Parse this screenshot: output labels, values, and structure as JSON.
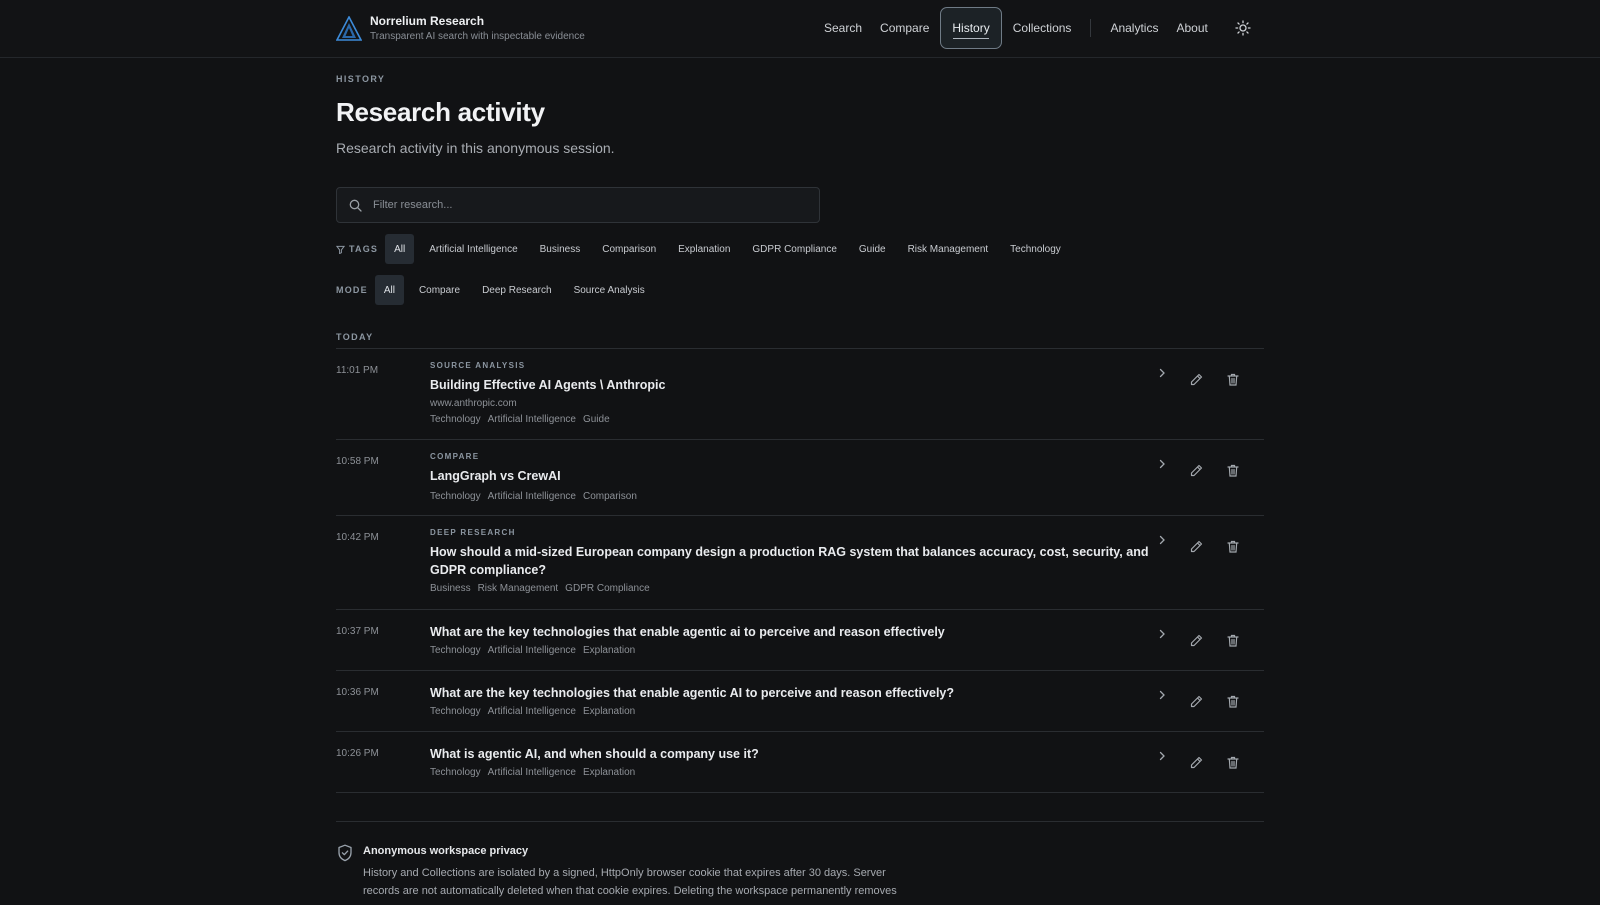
{
  "header": {
    "brand_name": "Norrelium Research",
    "brand_tagline": "Transparent AI search with inspectable evidence",
    "nav": {
      "search": "Search",
      "compare": "Compare",
      "history": "History",
      "collections": "Collections",
      "analytics": "Analytics",
      "about": "About"
    },
    "active_nav": "History"
  },
  "page": {
    "eyebrow": "HISTORY",
    "title": "Research activity",
    "subtitle": "Research activity in this anonymous session."
  },
  "search": {
    "placeholder": "Filter research...",
    "value": ""
  },
  "filters": {
    "tags_label": "TAGS",
    "tags": [
      "All",
      "Artificial Intelligence",
      "Business",
      "Comparison",
      "Explanation",
      "GDPR Compliance",
      "Guide",
      "Risk Management",
      "Technology"
    ],
    "mode_label": "MODE",
    "modes": [
      "All",
      "Compare",
      "Deep Research",
      "Source Analysis"
    ]
  },
  "history": {
    "group_label": "TODAY",
    "items": [
      {
        "time": "11:01 PM",
        "mode": "SOURCE ANALYSIS",
        "title": "Building Effective AI Agents \\ Anthropic",
        "url": "www.anthropic.com",
        "tags": [
          "Technology",
          "Artificial Intelligence",
          "Guide"
        ]
      },
      {
        "time": "10:58 PM",
        "mode": "COMPARE",
        "title": "LangGraph vs CrewAI",
        "tags": [
          "Technology",
          "Artificial Intelligence",
          "Comparison"
        ]
      },
      {
        "time": "10:42 PM",
        "mode": "DEEP RESEARCH",
        "title": "How should a mid-sized European company design a production RAG system that balances accuracy, cost, security, and GDPR compliance?",
        "tags": [
          "Business",
          "Risk Management",
          "GDPR Compliance"
        ]
      },
      {
        "time": "10:37 PM",
        "title": "What are the key technologies that enable agentic ai to perceive and reason effectively",
        "tags": [
          "Technology",
          "Artificial Intelligence",
          "Explanation"
        ]
      },
      {
        "time": "10:36 PM",
        "title": "What are the key technologies that enable agentic AI to perceive and reason effectively?",
        "tags": [
          "Technology",
          "Artificial Intelligence",
          "Explanation"
        ]
      },
      {
        "time": "10:26 PM",
        "title": "What is agentic AI, and when should a company use it?",
        "tags": [
          "Technology",
          "Artificial Intelligence",
          "Explanation"
        ]
      }
    ]
  },
  "privacy": {
    "title": "Anonymous workspace privacy",
    "text": "History and Collections are isolated by a signed, HttpOnly browser cookie that expires after 30 days. Server records are not automatically deleted when that cookie expires. Deleting the workspace permanently removes"
  },
  "icons": {
    "logo": "triangle-logo-icon",
    "theme": "sun-icon",
    "search": "search-icon",
    "tags": "filter-funnel-icon",
    "open": "chevron-right-icon",
    "edit": "pencil-icon",
    "delete": "trash-icon",
    "privacy": "shield-check-icon"
  },
  "colors": {
    "background": "#111214",
    "accent_logo": "#3d8bd9"
  }
}
